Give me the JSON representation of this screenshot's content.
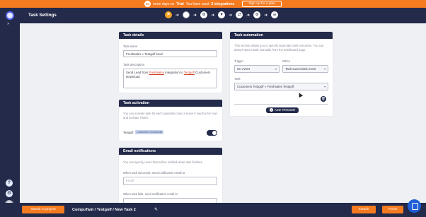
{
  "trial_bar": {
    "days_left": "34",
    "text_before": "more days on",
    "plan": "Trial",
    "text_middle": "You have used",
    "usage": "2 integrations",
    "signup_label": "Sign up for a plan"
  },
  "header": {
    "title": "Task Settings"
  },
  "steps": [
    {
      "icon": "flag-icon",
      "glyph": "⚑"
    },
    {
      "icon": "step-current-icon",
      "glyph": "▢"
    },
    {
      "icon": "gear-icon",
      "glyph": "⚙"
    },
    {
      "icon": "filter-icon",
      "glyph": "▼"
    },
    {
      "icon": "shuffle-icon",
      "glyph": "⇄"
    },
    {
      "icon": "gear-icon",
      "glyph": "⚙"
    },
    {
      "icon": "list-icon",
      "glyph": "☰"
    }
  ],
  "task_details": {
    "title": "Task details",
    "name_label": "Task name",
    "name_value": "Freshsales » Testgolf local",
    "description_label": "Task description",
    "description_prefix": "Send Lead from",
    "description_link1": "Freshsales",
    "description_middle": "integration to",
    "description_link2": "Testgolf",
    "description_suffix": "Customers Download"
  },
  "task_activation": {
    "title": "Task activation",
    "description": "You can activate task for each operation now or leave it inactive for now and activate it later.",
    "integration_label": "Testgolf",
    "chip_label": "Customers Download"
  },
  "email_notifications": {
    "title": "Email notifications",
    "description": "You can specify users that will be notified when task finishes.",
    "success_label": "When task succeeds, send notification email to",
    "success_placeholder": "Email",
    "fail_label": "When task fails, send notification email to"
  },
  "task_automation": {
    "title": "Task automation",
    "description": "This section allows you to specify automatic task execution. You can always start a task manually from the dashboard page.",
    "trigger_label": "Trigger",
    "trigger_value": "On event",
    "when_label": "When",
    "when_value": "Task succeeded event",
    "task_label": "Task",
    "task_value": "Customers Testgolf » Freshsales Testgolf",
    "add_trigger_label": "ADD TRIGGER"
  },
  "footer": {
    "back_to_project": "Back to project",
    "breadcrumb": "CompuTant / Testgolf / New Task 2",
    "back": "Back",
    "finish": "Finish"
  },
  "colors": {
    "navy": "#232a4a",
    "accent_orange": "#f47b20",
    "active_step": "#f5a623"
  }
}
